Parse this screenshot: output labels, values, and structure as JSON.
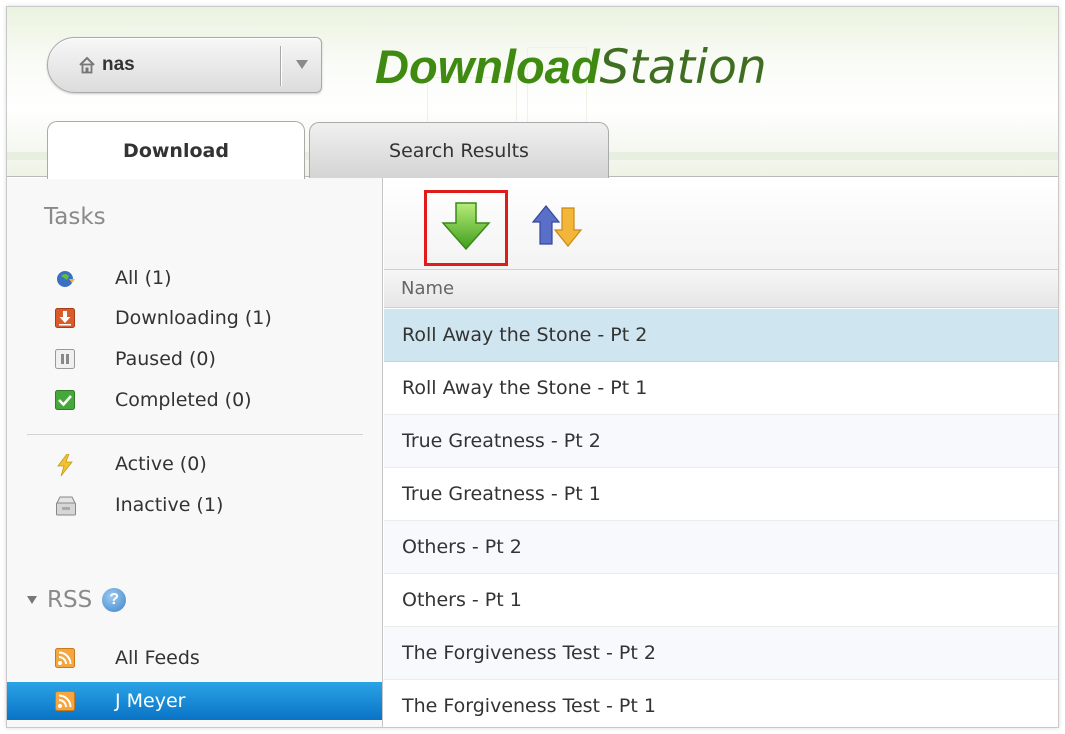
{
  "header": {
    "nas_label": "nas",
    "logo_bold": "Download",
    "logo_light": "Station"
  },
  "tabs": [
    {
      "label": "Download",
      "active": true
    },
    {
      "label": "Search Results",
      "active": false
    }
  ],
  "sidebar": {
    "tasks_title": "Tasks",
    "task_items": [
      {
        "label": "All (1)",
        "icon": "all-tasks-icon"
      },
      {
        "label": "Downloading (1)",
        "icon": "downloading-icon"
      },
      {
        "label": "Paused (0)",
        "icon": "paused-icon"
      },
      {
        "label": "Completed (0)",
        "icon": "completed-icon"
      }
    ],
    "status_items": [
      {
        "label": "Active (0)",
        "icon": "lightning-icon"
      },
      {
        "label": "Inactive (1)",
        "icon": "inactive-icon"
      }
    ],
    "rss_title": "RSS",
    "rss_help": "?",
    "rss_items": [
      {
        "label": "All Feeds",
        "icon": "rss-feed-icon",
        "selected": false
      },
      {
        "label": "J Meyer",
        "icon": "rss-feed-icon",
        "selected": true
      }
    ]
  },
  "toolbar": {
    "add_icon": "green-down-arrow-icon",
    "sort_icon": "up-down-arrows-icon"
  },
  "table": {
    "column_name": "Name",
    "rows": [
      "Roll Away the Stone - Pt 2",
      "Roll Away the Stone - Pt 1",
      "True Greatness - Pt 2",
      "True Greatness - Pt 1",
      "Others - Pt 2",
      "Others - Pt 1",
      "The Forgiveness Test - Pt 2",
      "The Forgiveness Test - Pt 1"
    ],
    "selected_row": 0
  },
  "colors": {
    "logo_green": "#3f8a10",
    "selection_blue": "#0a74c6",
    "highlight_red": "#e01b1b",
    "selected_row": "#cfe6f1"
  }
}
